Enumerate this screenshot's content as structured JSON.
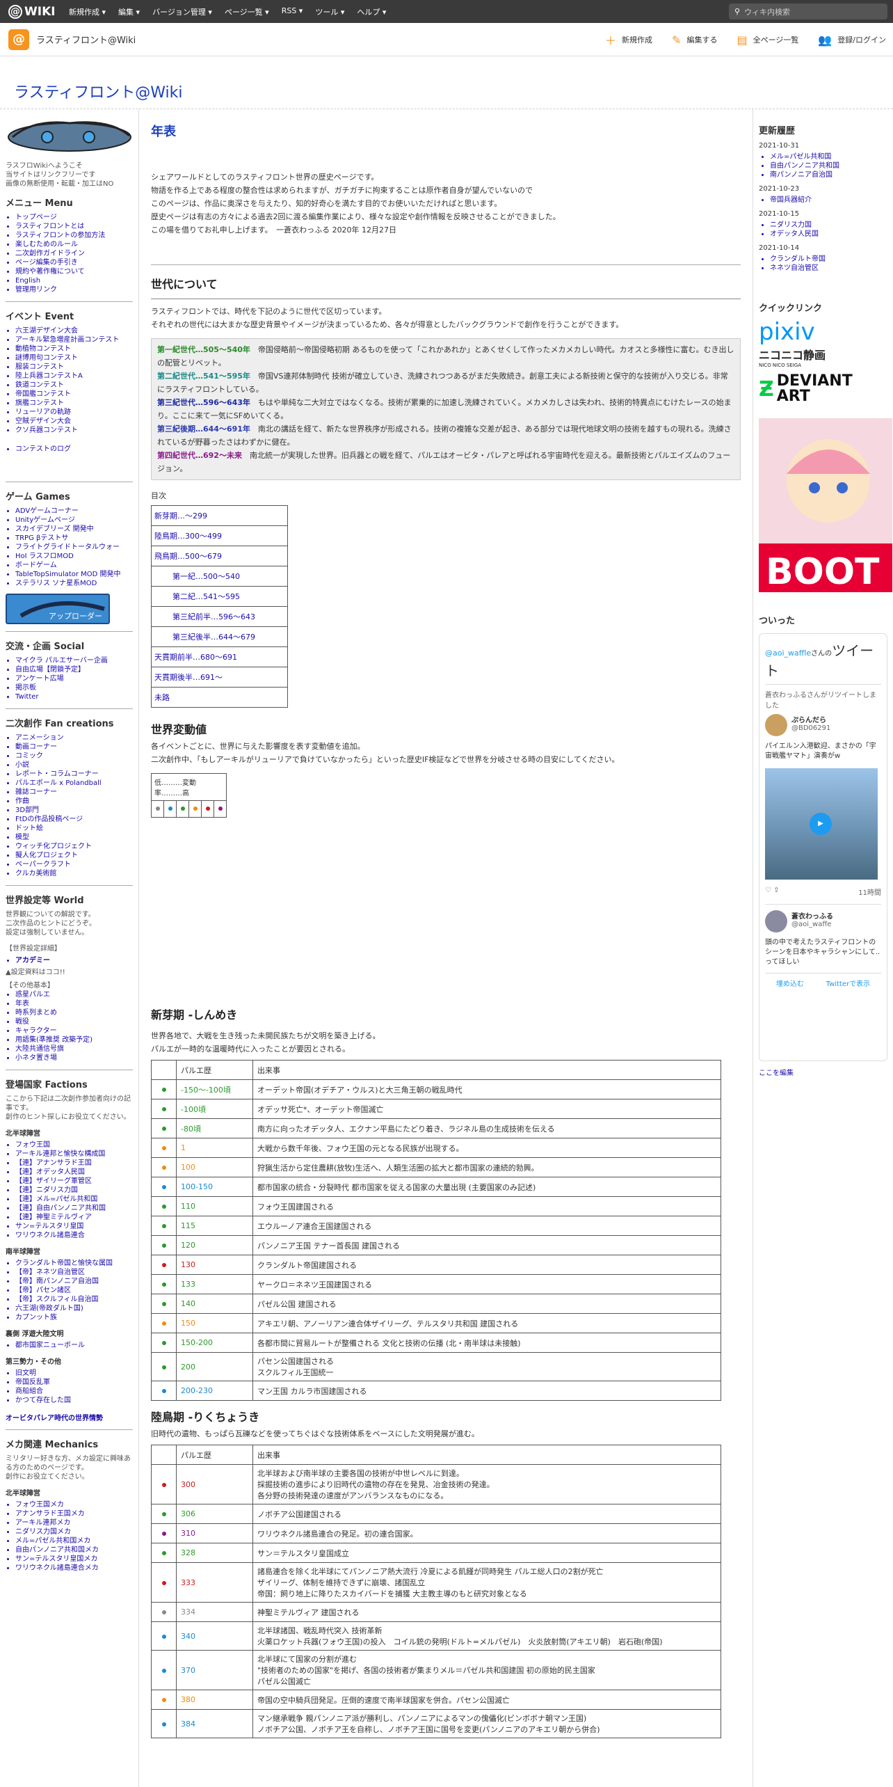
{
  "topbar": {
    "logo": "WIKI",
    "menu": [
      "新規作成 ▾",
      "編集 ▾",
      "バージョン管理 ▾",
      "ページ一覧 ▾",
      "RSS ▾",
      "ツール ▾",
      "ヘルプ ▾"
    ],
    "search_placeholder": "ウィキ内検索"
  },
  "header": {
    "site_name": "ラスティフロント@Wiki",
    "actions": [
      "新規作成",
      "編集する",
      "全ページ一覧",
      "登録/ログイン"
    ]
  },
  "site_title": "ラスティフロント@Wiki",
  "left": {
    "intro": [
      "ラスフロWikiへようこそ",
      "当サイトはリンクフリーです",
      "画像の無断使用・転載・加工はNO"
    ],
    "menu_title": "メニュー Menu",
    "menu_items": [
      "トップページ",
      "ラスティフロントとは",
      "ラスティフロントの参加方法",
      "楽しむためのルール",
      "二次創作ガイドライン",
      "ページ編集の手引き",
      "規約や著作権について",
      "English",
      "管理用リンク"
    ],
    "event_title": "イベント Event",
    "event_items": [
      "六王湖デザイン大会",
      "アーキル緊急増産計画コンテスト",
      "動植物コンテスト",
      "謎博用句コンテスト",
      "服装コンテスト",
      "陸上兵器コンテストA",
      "鉄道コンテスト",
      "帝国艦コンテスト",
      "旗艦コンテスト",
      "リューリアの軌跡",
      "空賊デザイン大会",
      "クソ兵器コンテスト"
    ],
    "contest_log": "コンテストのログ",
    "game_title": "ゲーム Games",
    "game_items": [
      "ADVゲームコーナー",
      "Unityゲームページ",
      "スカイデブリーズ 開発中",
      "TRPG βテストサ",
      "フライトグライドトータルウォー",
      "HoI ラスフロMOD",
      "ボードゲーム",
      "TableTopSimulator MOD 開発中",
      "ステラリス ソナ星系MOD"
    ],
    "social_title": "交流・企画 Social",
    "social_items": [
      "マイクラ パルエサーバー企画",
      "自由広場【閉鎖予定】",
      "アンケート広場",
      "掲示板",
      "Twitter"
    ],
    "fan_title": "二次創作 Fan creations",
    "fan_items": [
      "アニメーション",
      "動画コーナー",
      "コミック",
      "小説",
      "レポート・コラムコーナー",
      "パルエボール x Polandball",
      "雑誌コーナー",
      "作曲",
      "3D部門",
      "FtDの作品投稿ページ",
      "ドット絵",
      "模型",
      "ウィッチ化プロジェクト",
      "擬人化プロジェクト",
      "ペーパークラフト",
      "クルカ美術館"
    ],
    "world_title": "世界設定等 World",
    "world_text": [
      "世界観についての解説です。",
      "二次作品のヒントにどうぞ。",
      "設定は強制していません。"
    ],
    "world_detail": "【世界設定詳細】",
    "academy": "アカデミー",
    "coming": "▲設定資料はココ!!",
    "other_basic": "【その他基本】",
    "basic_items": [
      "惑星パルエ",
      "年表",
      "時系列まとめ",
      "戦役",
      "キャラクター",
      "用語集(準推奨 改築予定)",
      "大陸共通信号旗",
      "小ネタ置き場"
    ],
    "factions_title": "登場国家 Factions",
    "factions_text": [
      "ここから下記は二次創作参加者向けの記事です。",
      "創作のヒント探しにお役立てください。"
    ],
    "north": "北半球陣営",
    "north_items": [
      "フォウ王国",
      "アーキル連邦と愉快な構成国",
      "【連】アナンサラド王国",
      "【連】オデッタ人民国",
      "【連】ザイリーグ軍管区",
      "【連】ニダリス力国",
      "【連】メル=パゼル共和国",
      "【連】自由パンノニア共和国",
      "【連】神聖ミテルヴィア",
      "サン=テルスタリ皇国",
      "ワリウネクル諸島連合"
    ],
    "south": "南半球陣営",
    "south_items": [
      "クランダルト帝国と愉快な属国",
      "【帝】ネネツ自治管区",
      "【帝】南パンノニア自治国",
      "【帝】パセン諸区",
      "【帝】スクルフィル自治国",
      "六王湖(帝政ダルト国)",
      "カプンット族"
    ],
    "ura": "裏側 浮遊大陸文明",
    "ura_items": [
      "都市国家ニューボール"
    ],
    "third": "第三勢力・その他",
    "third_items": [
      "旧文明",
      "帝国反乱軍",
      "商船組合",
      "かつて存在した国"
    ],
    "orbita": "オービタパレア時代の世界情勢",
    "mecha_title": "メカ関連 Mechanics",
    "mecha_text": [
      "ミリタリー好きな方、メカ設定に興味ある方のためのページです。",
      "創作にお役立てください。"
    ],
    "mecha_north": "北半球陣営",
    "mecha_items": [
      "フォウ王国メカ",
      "アナンサラド王国メカ",
      "アーキル連邦メカ",
      "ニダリス力国メカ",
      "メル=パゼル共和国メカ",
      "自由パンノニア共和国メカ",
      "サン=テルスタリ皇国メカ",
      "ワリウネクル諸島連合メカ"
    ]
  },
  "main": {
    "page_title": "年表",
    "intro": [
      "シェアワールドとしてのラスティフロント世界の歴史ページです。",
      "物語を作る上である程度の整合性は求められますが、ガチガチに拘束することは原作者自身が望んでいないので",
      "このページは、作品に奥深さを与えたり、知的好奇心を満たす目的でお使いいただければと思います。",
      "歴史ページは有志の方々による過去2回に渡る編集作業により、様々な設定や創作情報を反映させることができました。",
      "この場を借りてお礼申し上げます。　一蒼衣わっふる 2020年 12月27日"
    ],
    "gen_title": "世代について",
    "gen_text": [
      "ラスティフロントでは、時代を下記のように世代で区切っています。",
      "それぞれの世代には大まかな歴史背景やイメージが決まっているため、各々が得意としたバックグラウンドで創作を行うことができます。"
    ],
    "gens": [
      {
        "label": "第一紀世代…505～540年",
        "text": "帝国侵略前～帝国侵略初期 あるものを使って「これかあれか」とあくせくして作ったメカメカしい時代。カオスと多様性に富む。むき出しの配管とリベット。",
        "color": "#2a8a2a"
      },
      {
        "label": "第二紀世代…541～595年",
        "text": "帝国VS連邦体制時代 技術が確立していき、洗練されつつあるがまだ失敗続き。創意工夫による新技術と保守的な技術が入り交じる。非常にラスティフロントしている。",
        "color": "#1a8a8a"
      },
      {
        "label": "第三紀世代…596～643年",
        "text": "もはや単純な二大対立ではなくなる。技術が累乗的に加速し洗練されていく。メカメカしさは失われ、技術的特異点にむけたレースの始まり。ここに来て一気にSFめいてくる。",
        "color": "#1a2aa0"
      },
      {
        "label": "第三紀後期…644～691年",
        "text": "南北の講話を経て、新たな世界秩序が形成される。技術の複雑な交差が起き、ある部分では現代地球文明の技術を越すもの現れる。洗練されているが野暮ったさはわずかに健在。",
        "color": "#2a3ab0"
      },
      {
        "label": "第四紀世代…692～未来",
        "text": "南北統一が実現した世界。旧兵器との戦を経て、パルエはオービタ・パレアと呼ばれる宇宙時代を迎える。最新技術とパルエイズムのフュージョン。",
        "color": "#8a1a8a"
      }
    ],
    "toc_label": "目次",
    "toc": [
      "新芽期…～299",
      "陸鳥期…300～499",
      "飛鳥期…500～679",
      "第一紀…500～540",
      "第二紀…541～595",
      "第三紀前半…596～643",
      "第三紀後半…644～679",
      "天貫期前半…680～691",
      "天貫期後半…691～",
      "未路"
    ],
    "change_title": "世界変動値",
    "change_text": [
      "各イベントごとに、世界に与えた影響度を表す変動値を追加。",
      "二次創作中、「もしアーキルがリューリアで負けていなかったら」といった歴史IF検証などで世界を分岐させる時の目安にしてください。"
    ],
    "change_scale": "低………変動率………高",
    "change_colors": [
      "#888",
      "#1a8ad0",
      "#2a9a2a",
      "#f08a10",
      "#d01a1a",
      "#8a1a8a"
    ],
    "shinme_title": "新芽期 -しんめき",
    "shinme_text": [
      "世界各地で、大戦を生き残った未開民族たちが文明を築き上げる。",
      "パルエが一時的な温暖時代に入ったことが要因とされる。"
    ],
    "col_year": "パルエ歴",
    "col_event": "出来事",
    "shinme_rows": [
      {
        "c": "#2a9a2a",
        "y": "-150～-100頃",
        "e": "オーデット帝国(オデチア・ウルス)と大三角王朝の戦乱時代"
      },
      {
        "c": "#2a9a2a",
        "y": "-100頃",
        "e": "オデッサ死亡*、オーデット帝国滅亡"
      },
      {
        "c": "#2a9a2a",
        "y": "-80頃",
        "e": "南方に向ったオデッタ人、エクナン平島にたどり着き、ラジネル島の生成技術を伝える"
      },
      {
        "c": "#f08a10",
        "y": "1",
        "e": "大戦から数千年後、フォウ王国の元となる民族が出現する。"
      },
      {
        "c": "#f08a10",
        "y": "100",
        "e": "狩猟生活から定住農耕(放牧)生活へ、人類生活圏の拡大と都市国家の連続的勃興。"
      },
      {
        "c": "#1a8ad0",
        "y": "100-150",
        "e": "都市国家の統合・分裂時代 都市国家を従える国家の大量出現 (主要国家のみ記述)"
      },
      {
        "c": "#2a9a2a",
        "y": "110",
        "e": "フォウ王国建国される"
      },
      {
        "c": "#2a9a2a",
        "y": "115",
        "e": "エウルーノア連合王国建国される"
      },
      {
        "c": "#2a9a2a",
        "y": "120",
        "e": "パンノニア王国 テナー首長国 建国される"
      },
      {
        "c": "#d01a1a",
        "y": "130",
        "e": "クランダルト帝国建国される"
      },
      {
        "c": "#2a9a2a",
        "y": "133",
        "e": "ヤークロ＝ネネツ王国建国される"
      },
      {
        "c": "#2a9a2a",
        "y": "140",
        "e": "パゼル公国 建国される"
      },
      {
        "c": "#f08a10",
        "y": "150",
        "e": "アキエリ朝、アノーリアン連合体ザイリーグ、テルスタリ共和国 建国される"
      },
      {
        "c": "#2a9a2a",
        "y": "150-200",
        "e": "各都市間に貿易ルートが整備される 文化と技術の伝播 (北・南半球は未接触)"
      },
      {
        "c": "#2a9a2a",
        "y": "200",
        "e": "パセン公国建国される / スクルフィル王国統一"
      },
      {
        "c": "#1a8ad0",
        "y": "200-230",
        "e": "マン王国 カルラ市国建国される"
      }
    ],
    "rikuchou_title": "陸鳥期 -りくちょうき",
    "rikuchou_text": "旧時代の遺物、もっぱら瓦礫などを使ってちぐはぐな技術体系をベースにした文明発展が進む。",
    "rikuchou_rows": [
      {
        "c": "#d01a1a",
        "y": "300",
        "e": "北半球および南半球の主要各国の技術が中世レベルに到達。 / 採掘技術の進歩により旧時代の遺物の存在を発見、冶金技術の発達。 / 各分野の技術発達の速度がアンバランスなものになる。"
      },
      {
        "c": "#2a9a2a",
        "y": "306",
        "e": "ノボチア公国建国される"
      },
      {
        "c": "#8a1a8a",
        "y": "310",
        "e": "ワリウネクル諸島連合の発足。初の連合国家。"
      },
      {
        "c": "#2a9a2a",
        "y": "328",
        "e": "サン＝テルスタリ皇国成立"
      },
      {
        "c": "#d01a1a",
        "y": "333",
        "e": "諸島連合を除く北半球にてパンノニア熱大流行 冷夏による飢饉が同時発生 パルエ総人口の2割が死亡 / ザイリーグ、体制を維持できずに崩壊、諸国乱立 / 帝国：飼り地上に降りたスカイバードを捕獲 大主教主導のもと研究対象となる"
      },
      {
        "c": "#888",
        "y": "334",
        "e": "神聖ミテルヴィア 建国される"
      },
      {
        "c": "#1a8ad0",
        "y": "340",
        "e": "北半球諸国、戦乱時代突入 技術革新 / 火薬ロケット兵器(フォウ王国)の投入　コイル銃の発明(ドルト=メルパゼル)　火炎放射筒(アキエリ朝)　岩石砲(帝国)"
      },
      {
        "c": "#1a8ad0",
        "y": "370",
        "e": "北半球にて国家の分割が進む / \"技術者のための国家\"を掲げ、各国の技術者が集まりメル＝パゼル共和国建国 初の原始的民主国家 / パゼル公国滅亡"
      },
      {
        "c": "#f08a10",
        "y": "380",
        "e": "帝国の空中騎兵団発足。圧倒的速度で南半球国家を併合。パセン公国滅亡"
      },
      {
        "c": "#1a8ad0",
        "y": "384",
        "e": "マン継承戦争 親パンノニア派が勝利し、パンノニアによるマンの傀儡化(ビンボボナ朝マン王国) / ノボチア公国、ノボチア王を自称し、ノボチア王国に国号を変更(パンノニアのアキエリ朝から併合)"
      }
    ]
  },
  "right": {
    "history_title": "更新履歴",
    "history": [
      {
        "date": "2021-10-31",
        "items": [
          "メル=パゼル共和国",
          "自由パンノニア共和国",
          "南パンノニア自治国"
        ]
      },
      {
        "date": "2021-10-23",
        "items": [
          "帝国兵器紹介"
        ]
      },
      {
        "date": "2021-10-15",
        "items": [
          "ニダリス力国",
          "オデッタ人民国"
        ]
      },
      {
        "date": "2021-10-14",
        "items": [
          "クランダルト帝国",
          "ネネツ自治管区"
        ]
      }
    ],
    "quick_title": "クイックリンク",
    "pixiv": "pixiv",
    "nico": "ニコニコ静画",
    "nico_sub": "NICO NICO SEIGA",
    "deviant": "DEVIANT ART",
    "boot": "BOOT",
    "twitter_title": "ついった",
    "tw_header_user": "@aoi_waffle",
    "tw_header_suffix": "さんの",
    "tw_header_big": "ツイート",
    "tw_retweet": "蒼衣わっふるさんがリツイートしました",
    "tw_name": "ぷらんだら",
    "tw_handle": "@BD06291",
    "tw_text": "パイエルン入港歓迎、まさかの「宇宙戦艦ヤマト」演奏がw",
    "tw_time": "11時間",
    "tw_name2": "蒼衣わっふる",
    "tw_handle2": "@aoi_waffe",
    "tw_text2": "頭の中で考えたラスティフロントのシーンを日本やキャラシャンにして..ってほしい",
    "tw_embed": "埋め込む",
    "tw_view": "Twitterで表示",
    "edit_link": "ここを編集"
  }
}
